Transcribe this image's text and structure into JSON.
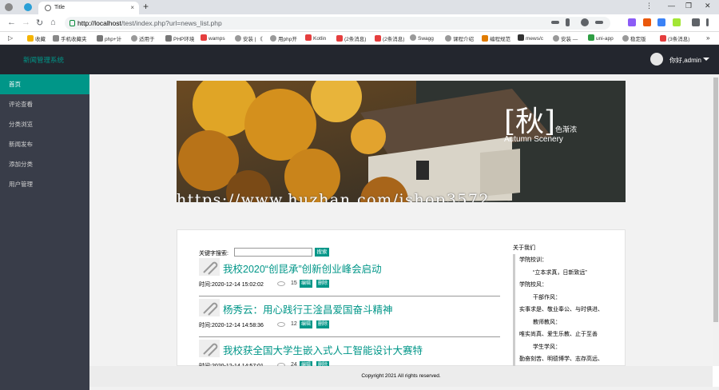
{
  "browser": {
    "tab_title": "Title",
    "new_tab": "+",
    "url_host": "http://localhost",
    "url_path": "/test/index.php?url=news_list.php",
    "bookmarks": [
      "收藏",
      "手机收藏夹",
      "php+计",
      "适用于",
      "PHP环境",
      "wamps",
      "安装 | 《",
      "用php开",
      "Kotlin",
      "(2条消息)",
      "(2条消息)",
      "Swagg",
      "课程介绍",
      "编程规范",
      "mews/c",
      "安装 —",
      "uni-app",
      "稳定版",
      "(3条消息)"
    ]
  },
  "app": {
    "brand": "新闻管理系统",
    "user_greeting": "你好,admin"
  },
  "sidebar": {
    "items": [
      {
        "label": "首页",
        "active": true
      },
      {
        "label": "评论查看",
        "active": false
      },
      {
        "label": "分类浏览",
        "active": false
      },
      {
        "label": "新闻发布",
        "active": false
      },
      {
        "label": "添加分类",
        "active": false
      },
      {
        "label": "用户管理",
        "active": false
      }
    ]
  },
  "banner": {
    "big_char": "[秋]",
    "sub_char": "色渐浓",
    "sub_text": "Autumn Scenery",
    "watermark": "https://www.huzhan.com/ishop3572"
  },
  "search": {
    "label": "关键字搜索:",
    "value": "",
    "button": "搜索"
  },
  "articles": [
    {
      "title": "我校2020“创昆承”创新创业峰会启动",
      "time": "时间:2020-12-14 15:02:02",
      "views": "15",
      "edit": "编辑",
      "delete": "删除"
    },
    {
      "title": "杨秀云：用心践行王淦昌爱国奋斗精神",
      "time": "时间:2020-12-14 14:58:36",
      "views": "12",
      "edit": "编辑",
      "delete": "删除"
    },
    {
      "title": "我校获全国大学生嵌入式人工智能设计大赛特",
      "time": "时间:2020-12-14 14:57:01",
      "views": "24",
      "edit": "编辑",
      "delete": "删除"
    }
  ],
  "about": {
    "title": "关于我们",
    "lines": [
      {
        "text": "学院校训：",
        "indent": false
      },
      {
        "text": "“立本求真，日新致远”",
        "indent": true
      },
      {
        "text": "学院校风：",
        "indent": false
      },
      {
        "text": "干部作风：",
        "indent": true
      },
      {
        "text": "实事求是、敬业奉公、与时俱进、",
        "indent": false
      },
      {
        "text": "教师教风：",
        "indent": true
      },
      {
        "text": "唯实尚真、爱生乐教、止于至善",
        "indent": false
      },
      {
        "text": "学生学风：",
        "indent": true
      },
      {
        "text": "勤奋刻苦、明德博学、志存高远、",
        "indent": false
      }
    ]
  },
  "footer": "Copyright 2021 All rights reserved.",
  "colors": {
    "accent": "#009688",
    "topbar": "#23262e",
    "sidebar": "#393d49"
  }
}
